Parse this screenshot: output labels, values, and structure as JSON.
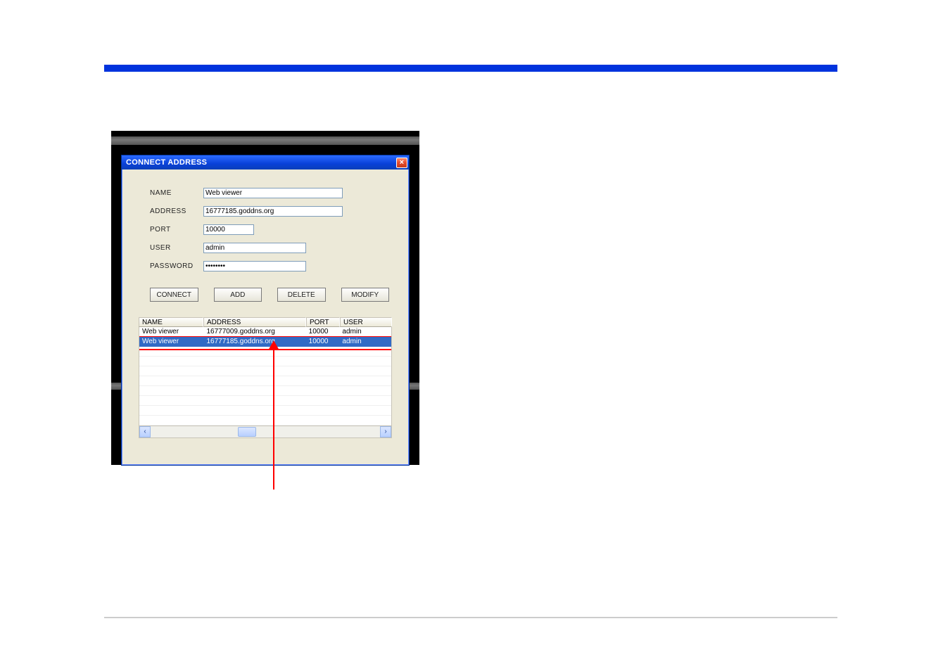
{
  "dialog": {
    "title": "CONNECT ADDRESS"
  },
  "form": {
    "labels": {
      "name": "NAME",
      "address": "ADDRESS",
      "port": "PORT",
      "user": "USER",
      "password": "PASSWORD"
    },
    "values": {
      "name": "Web viewer",
      "address": "16777185.goddns.org",
      "port": "10000",
      "user": "admin",
      "password": "********"
    }
  },
  "buttons": {
    "connect": "CONNECT",
    "add": "ADD",
    "delete": "DELETE",
    "modify": "MODIFY"
  },
  "list": {
    "headers": {
      "name": "NAME",
      "address": "ADDRESS",
      "port": "PORT",
      "user": "USER"
    },
    "rows": [
      {
        "name": "Web viewer",
        "address": "16777009.goddns.org",
        "port": "10000",
        "user": "admin",
        "selected": false
      },
      {
        "name": "Web viewer",
        "address": "16777185.goddns.org",
        "port": "10000",
        "user": "admin",
        "selected": true
      }
    ]
  }
}
